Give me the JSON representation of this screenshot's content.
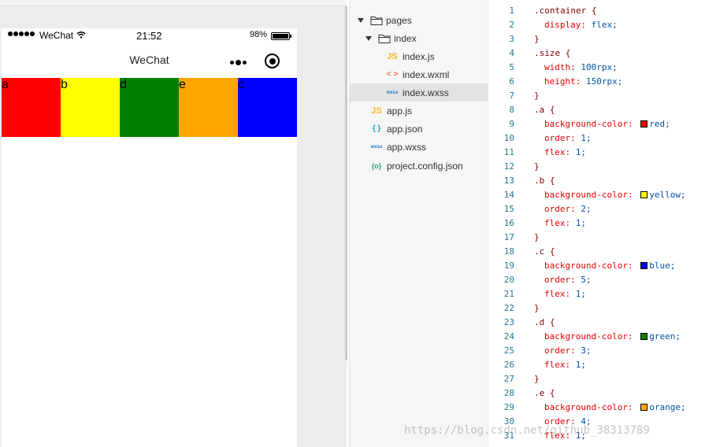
{
  "simulator": {
    "status_bar": {
      "carrier": "WeChat",
      "time": "21:52",
      "battery": "98%"
    },
    "nav_title": "WeChat",
    "boxes": [
      {
        "label": "a",
        "color": "#ff0000"
      },
      {
        "label": "b",
        "color": "#ffff00"
      },
      {
        "label": "d",
        "color": "#008000"
      },
      {
        "label": "e",
        "color": "#ffa500"
      },
      {
        "label": "c",
        "color": "#0000ff"
      }
    ]
  },
  "explorer": {
    "items": [
      {
        "label": "pages",
        "icon": "folder-open-icon"
      },
      {
        "label": "index",
        "icon": "folder-open-icon"
      },
      {
        "label": "index.js",
        "icon": "JS"
      },
      {
        "label": "index.wxml",
        "icon": "< >"
      },
      {
        "label": "index.wxss",
        "icon": "wxss"
      },
      {
        "label": "app.js",
        "icon": "JS"
      },
      {
        "label": "app.json",
        "icon": "{ }"
      },
      {
        "label": "app.wxss",
        "icon": "wxss"
      },
      {
        "label": "project.config.json",
        "icon": "{o}"
      }
    ]
  },
  "editor": {
    "lines": [
      {
        "n": "1",
        "sel": ".container {"
      },
      {
        "n": "2",
        "prop": "display:",
        "val": "flex;"
      },
      {
        "n": "3",
        "sel": "}"
      },
      {
        "n": "4",
        "sel": ".size {"
      },
      {
        "n": "5",
        "prop": "width:",
        "val": "100rpx;"
      },
      {
        "n": "6",
        "prop": "height:",
        "val": "150rpx;"
      },
      {
        "n": "7",
        "sel": "}"
      },
      {
        "n": "8",
        "sel": ".a {"
      },
      {
        "n": "9",
        "prop": "background-color:",
        "val": "red;",
        "swatch": "#ff0000"
      },
      {
        "n": "10",
        "prop": "order:",
        "val": "1;"
      },
      {
        "n": "11",
        "prop": "flex:",
        "val": "1;"
      },
      {
        "n": "12",
        "sel": "}"
      },
      {
        "n": "13",
        "sel": ".b {"
      },
      {
        "n": "14",
        "prop": "background-color:",
        "val": "yellow;",
        "swatch": "#ffff00"
      },
      {
        "n": "15",
        "prop": "order:",
        "val": "2;"
      },
      {
        "n": "16",
        "prop": "flex:",
        "val": "1;"
      },
      {
        "n": "17",
        "sel": "}"
      },
      {
        "n": "18",
        "sel": ".c {"
      },
      {
        "n": "19",
        "prop": "background-color:",
        "val": "blue;",
        "swatch": "#0000ff"
      },
      {
        "n": "20",
        "prop": "order:",
        "val": "5;"
      },
      {
        "n": "21",
        "prop": "flex:",
        "val": "1;"
      },
      {
        "n": "22",
        "sel": "}"
      },
      {
        "n": "23",
        "sel": ".d {"
      },
      {
        "n": "24",
        "prop": "background-color:",
        "val": "green;",
        "swatch": "#008000"
      },
      {
        "n": "25",
        "prop": "order:",
        "val": "3;"
      },
      {
        "n": "26",
        "prop": "flex:",
        "val": "1;"
      },
      {
        "n": "27",
        "sel": "}"
      },
      {
        "n": "28",
        "sel": ".e {"
      },
      {
        "n": "29",
        "prop": "background-color:",
        "val": "orange;",
        "swatch": "#ffa500"
      },
      {
        "n": "30",
        "prop": "order:",
        "val": "4;"
      },
      {
        "n": "31",
        "prop": "flex:",
        "val": "1;"
      }
    ]
  },
  "watermark": "https://blog.csdn.net/github_38313789"
}
